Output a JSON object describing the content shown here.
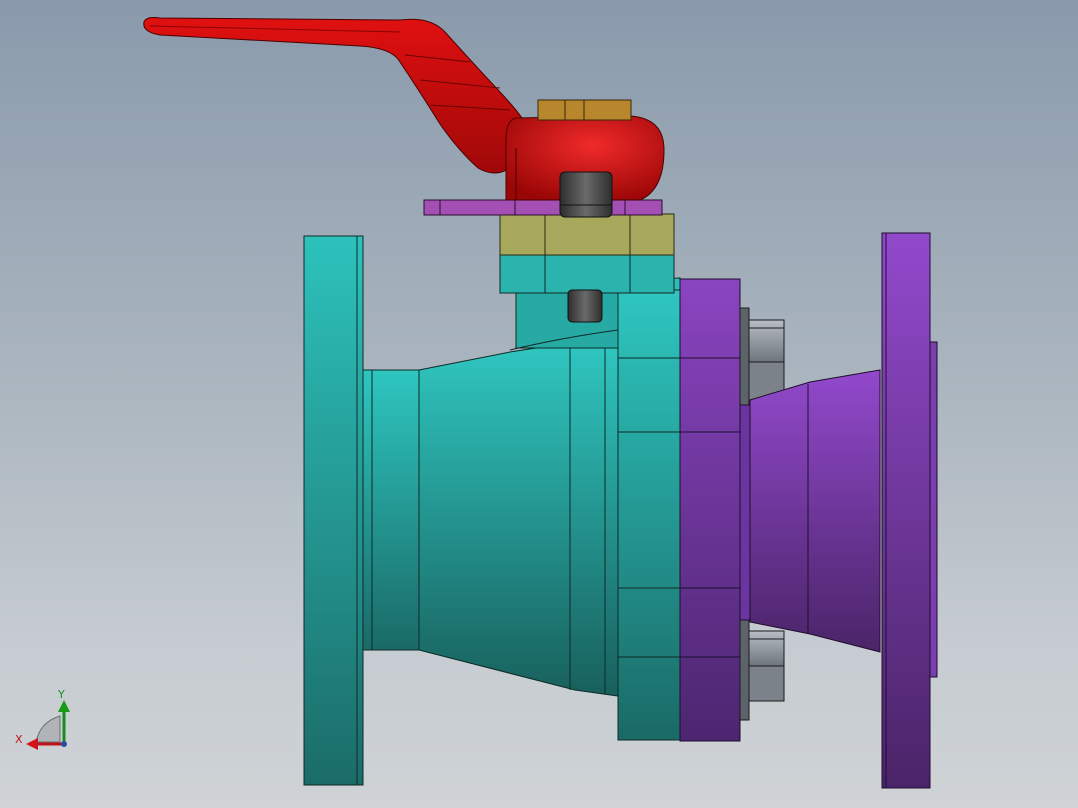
{
  "viewport": {
    "background_top": "#8a9aac",
    "background_bottom": "#cfd3d6"
  },
  "model": {
    "part_colors": {
      "body": "#2aaea8",
      "body_shadow": "#1b6e6a",
      "end_cap": "#8a45c0",
      "end_cap_shadow": "#4e2670",
      "handle": "#cf0a0a",
      "stem_nut": "#b8862c",
      "gland_plate": "#a44fb4",
      "packing_ring": "#a8a85a",
      "stem": "#4a4a4a",
      "bolt": "#9aa0a8"
    },
    "icons": [
      "valve-handle",
      "valve-body",
      "flange",
      "hex-bolt"
    ]
  },
  "triad": {
    "x_label": "X",
    "y_label": "Y",
    "x_color": "#c0121b",
    "y_color": "#1a8a1a"
  }
}
